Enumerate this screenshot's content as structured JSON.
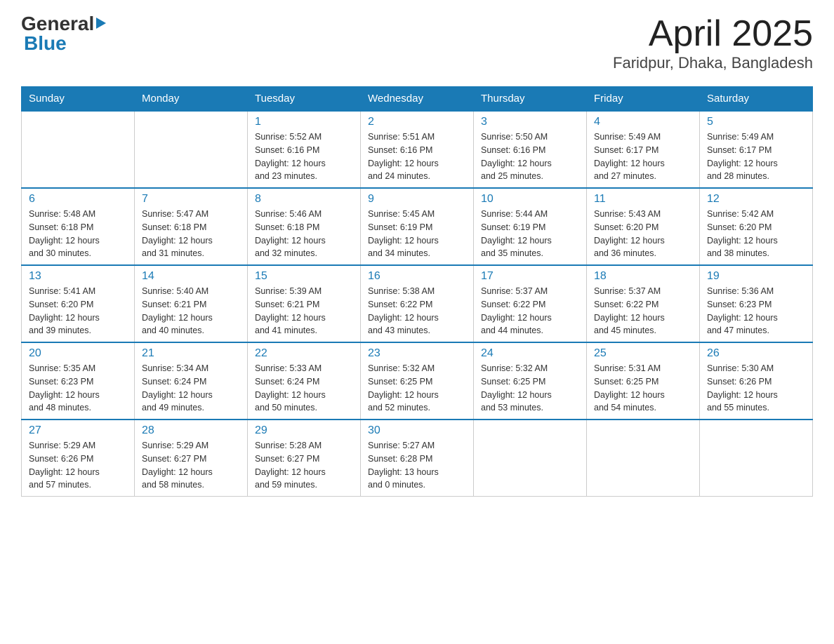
{
  "header": {
    "logo_general": "General",
    "logo_blue": "Blue",
    "title": "April 2025",
    "subtitle": "Faridpur, Dhaka, Bangladesh"
  },
  "days_of_week": [
    "Sunday",
    "Monday",
    "Tuesday",
    "Wednesday",
    "Thursday",
    "Friday",
    "Saturday"
  ],
  "weeks": [
    [
      {
        "day": "",
        "info": ""
      },
      {
        "day": "",
        "info": ""
      },
      {
        "day": "1",
        "info": "Sunrise: 5:52 AM\nSunset: 6:16 PM\nDaylight: 12 hours\nand 23 minutes."
      },
      {
        "day": "2",
        "info": "Sunrise: 5:51 AM\nSunset: 6:16 PM\nDaylight: 12 hours\nand 24 minutes."
      },
      {
        "day": "3",
        "info": "Sunrise: 5:50 AM\nSunset: 6:16 PM\nDaylight: 12 hours\nand 25 minutes."
      },
      {
        "day": "4",
        "info": "Sunrise: 5:49 AM\nSunset: 6:17 PM\nDaylight: 12 hours\nand 27 minutes."
      },
      {
        "day": "5",
        "info": "Sunrise: 5:49 AM\nSunset: 6:17 PM\nDaylight: 12 hours\nand 28 minutes."
      }
    ],
    [
      {
        "day": "6",
        "info": "Sunrise: 5:48 AM\nSunset: 6:18 PM\nDaylight: 12 hours\nand 30 minutes."
      },
      {
        "day": "7",
        "info": "Sunrise: 5:47 AM\nSunset: 6:18 PM\nDaylight: 12 hours\nand 31 minutes."
      },
      {
        "day": "8",
        "info": "Sunrise: 5:46 AM\nSunset: 6:18 PM\nDaylight: 12 hours\nand 32 minutes."
      },
      {
        "day": "9",
        "info": "Sunrise: 5:45 AM\nSunset: 6:19 PM\nDaylight: 12 hours\nand 34 minutes."
      },
      {
        "day": "10",
        "info": "Sunrise: 5:44 AM\nSunset: 6:19 PM\nDaylight: 12 hours\nand 35 minutes."
      },
      {
        "day": "11",
        "info": "Sunrise: 5:43 AM\nSunset: 6:20 PM\nDaylight: 12 hours\nand 36 minutes."
      },
      {
        "day": "12",
        "info": "Sunrise: 5:42 AM\nSunset: 6:20 PM\nDaylight: 12 hours\nand 38 minutes."
      }
    ],
    [
      {
        "day": "13",
        "info": "Sunrise: 5:41 AM\nSunset: 6:20 PM\nDaylight: 12 hours\nand 39 minutes."
      },
      {
        "day": "14",
        "info": "Sunrise: 5:40 AM\nSunset: 6:21 PM\nDaylight: 12 hours\nand 40 minutes."
      },
      {
        "day": "15",
        "info": "Sunrise: 5:39 AM\nSunset: 6:21 PM\nDaylight: 12 hours\nand 41 minutes."
      },
      {
        "day": "16",
        "info": "Sunrise: 5:38 AM\nSunset: 6:22 PM\nDaylight: 12 hours\nand 43 minutes."
      },
      {
        "day": "17",
        "info": "Sunrise: 5:37 AM\nSunset: 6:22 PM\nDaylight: 12 hours\nand 44 minutes."
      },
      {
        "day": "18",
        "info": "Sunrise: 5:37 AM\nSunset: 6:22 PM\nDaylight: 12 hours\nand 45 minutes."
      },
      {
        "day": "19",
        "info": "Sunrise: 5:36 AM\nSunset: 6:23 PM\nDaylight: 12 hours\nand 47 minutes."
      }
    ],
    [
      {
        "day": "20",
        "info": "Sunrise: 5:35 AM\nSunset: 6:23 PM\nDaylight: 12 hours\nand 48 minutes."
      },
      {
        "day": "21",
        "info": "Sunrise: 5:34 AM\nSunset: 6:24 PM\nDaylight: 12 hours\nand 49 minutes."
      },
      {
        "day": "22",
        "info": "Sunrise: 5:33 AM\nSunset: 6:24 PM\nDaylight: 12 hours\nand 50 minutes."
      },
      {
        "day": "23",
        "info": "Sunrise: 5:32 AM\nSunset: 6:25 PM\nDaylight: 12 hours\nand 52 minutes."
      },
      {
        "day": "24",
        "info": "Sunrise: 5:32 AM\nSunset: 6:25 PM\nDaylight: 12 hours\nand 53 minutes."
      },
      {
        "day": "25",
        "info": "Sunrise: 5:31 AM\nSunset: 6:25 PM\nDaylight: 12 hours\nand 54 minutes."
      },
      {
        "day": "26",
        "info": "Sunrise: 5:30 AM\nSunset: 6:26 PM\nDaylight: 12 hours\nand 55 minutes."
      }
    ],
    [
      {
        "day": "27",
        "info": "Sunrise: 5:29 AM\nSunset: 6:26 PM\nDaylight: 12 hours\nand 57 minutes."
      },
      {
        "day": "28",
        "info": "Sunrise: 5:29 AM\nSunset: 6:27 PM\nDaylight: 12 hours\nand 58 minutes."
      },
      {
        "day": "29",
        "info": "Sunrise: 5:28 AM\nSunset: 6:27 PM\nDaylight: 12 hours\nand 59 minutes."
      },
      {
        "day": "30",
        "info": "Sunrise: 5:27 AM\nSunset: 6:28 PM\nDaylight: 13 hours\nand 0 minutes."
      },
      {
        "day": "",
        "info": ""
      },
      {
        "day": "",
        "info": ""
      },
      {
        "day": "",
        "info": ""
      }
    ]
  ]
}
